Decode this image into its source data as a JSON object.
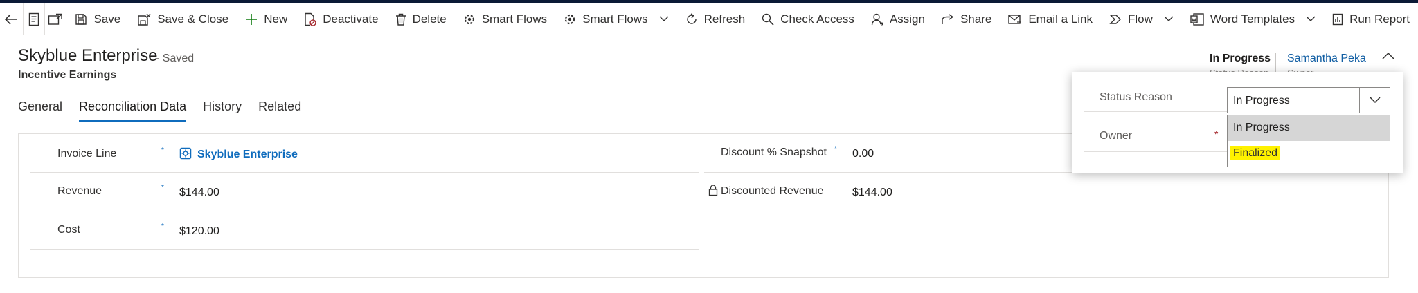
{
  "command_bar": {
    "save": "Save",
    "save_close": "Save & Close",
    "new": "New",
    "deactivate": "Deactivate",
    "delete": "Delete",
    "smart_flows_1": "Smart Flows",
    "smart_flows_2": "Smart Flows",
    "refresh": "Refresh",
    "check_access": "Check Access",
    "assign": "Assign",
    "share": "Share",
    "email_link": "Email a Link",
    "flow": "Flow",
    "word_templates": "Word Templates",
    "run_report": "Run Report"
  },
  "record": {
    "title": "Skyblue Enterprise",
    "saved": "- Saved",
    "entity": "Incentive Earnings"
  },
  "header_fields": {
    "status_value": "In Progress",
    "status_label": "Status Reason",
    "owner_value": "Samantha Peka",
    "owner_label": "Owner"
  },
  "tabs": [
    "General",
    "Reconciliation Data",
    "History",
    "Related"
  ],
  "form": {
    "invoice_line_label": "Invoice Line",
    "invoice_line_value": "Skyblue Enterprise",
    "revenue_label": "Revenue",
    "revenue_value": "$144.00",
    "cost_label": "Cost",
    "cost_value": "$120.00",
    "discount_label": "Discount % Snapshot",
    "discount_value": "0.00",
    "discounted_revenue_label": "Discounted Revenue",
    "discounted_revenue_value": "$144.00",
    "required_mark": "*"
  },
  "flyout": {
    "status_label": "Status Reason",
    "status_selected": "In Progress",
    "owner_label": "Owner",
    "owner_required": "*",
    "options": [
      "In Progress",
      "Finalized"
    ]
  },
  "colors": {
    "accent": "#0f6cbd",
    "highlight": "#fff200",
    "selected_option": "#d6d6d6"
  }
}
